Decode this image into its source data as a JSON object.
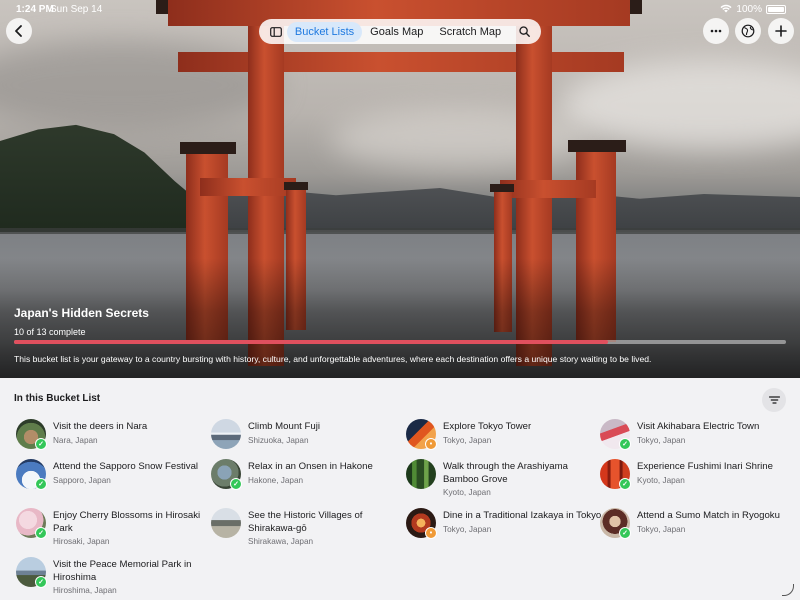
{
  "status_bar": {
    "time": "1:24 PM",
    "date": "Sun Sep 14",
    "battery": "100%"
  },
  "nav": {
    "back_icon": "chevron-left-icon",
    "sidebar_icon": "sidebar-icon",
    "tabs": [
      {
        "label": "Bucket Lists",
        "active": true
      },
      {
        "label": "Goals Map",
        "active": false
      },
      {
        "label": "Scratch Map",
        "active": false
      }
    ],
    "search_icon": "search-icon",
    "more_icon": "ellipsis-icon",
    "globe_icon": "globe-icon",
    "add_icon": "plus-icon"
  },
  "hero": {
    "title": "Japan's Hidden Secrets",
    "progress_label": "10 of 13 complete",
    "progress_fraction": 0.769,
    "description": "This bucket list is your gateway to a country bursting with history, culture, and unforgettable adventures, where each destination offers a unique story waiting to be lived."
  },
  "section": {
    "title": "In this Bucket List",
    "filter_icon": "filter-icon"
  },
  "colors": {
    "accent": "#1f7ae0",
    "progress": "#e0505e",
    "complete": "#34c759",
    "pending": "#f09a37"
  },
  "items": [
    {
      "title": "Visit the deers in Nara",
      "location": "Nara, Japan",
      "status": "complete"
    },
    {
      "title": "Climb Mount Fuji",
      "location": "Shizuoka, Japan",
      "status": "none"
    },
    {
      "title": "Explore Tokyo Tower",
      "location": "Tokyo, Japan",
      "status": "pending"
    },
    {
      "title": "Visit Akihabara Electric Town",
      "location": "Tokyo, Japan",
      "status": "complete"
    },
    {
      "title": "Attend the Sapporo Snow Festival",
      "location": "Sapporo, Japan",
      "status": "complete"
    },
    {
      "title": "Relax in an Onsen in Hakone",
      "location": "Hakone, Japan",
      "status": "complete"
    },
    {
      "title": "Walk through the Arashiyama Bamboo Grove",
      "location": "Kyoto, Japan",
      "status": "none"
    },
    {
      "title": "Experience Fushimi Inari Shrine",
      "location": "Kyoto, Japan",
      "status": "complete"
    },
    {
      "title": "Enjoy Cherry Blossoms in Hirosaki Park",
      "location": "Hirosaki, Japan",
      "status": "complete"
    },
    {
      "title": "See the Historic Villages of Shirakawa-gō",
      "location": "Shirakawa, Japan",
      "status": "none"
    },
    {
      "title": "Dine in a Traditional Izakaya in Tokyo",
      "location": "Tokyo, Japan",
      "status": "pending"
    },
    {
      "title": "Attend a Sumo Match in Ryogoku",
      "location": "Tokyo, Japan",
      "status": "complete"
    },
    {
      "title": "Visit the Peace Memorial Park in Hiroshima",
      "location": "Hiroshima, Japan",
      "status": "complete"
    }
  ]
}
